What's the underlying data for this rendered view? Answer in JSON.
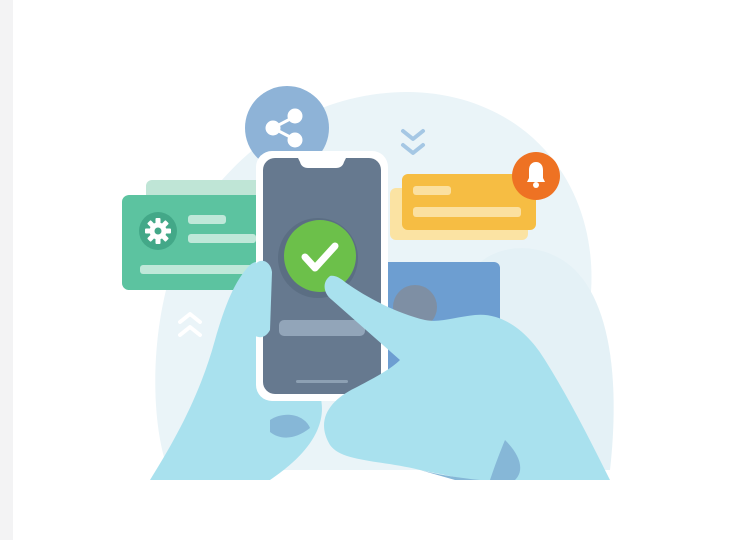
{
  "illustration": {
    "subject": "mobile-confirmation",
    "icons": [
      "share-icon",
      "gear-icon",
      "check-icon",
      "bell-icon",
      "chevron-down-icon",
      "chevron-up-icon"
    ],
    "colors": {
      "background": "#ffffff",
      "strip": "#f3f3f4",
      "blob": "#e9f4f8",
      "share_circle": "#8eb3d7",
      "green_card": "#5cc3a0",
      "green_card_back": "#b8e2d2",
      "yellow_card": "#f6bd43",
      "yellow_card_back": "#fbe4a6",
      "bell_circle": "#ee7223",
      "phone_body": "#ffffff",
      "phone_screen": "#66798f",
      "check_circle": "#6cc04a",
      "blue_card": "#6d9ed1",
      "hand": "#a9e1ee",
      "hand_shadow": "#86b7d7"
    }
  }
}
